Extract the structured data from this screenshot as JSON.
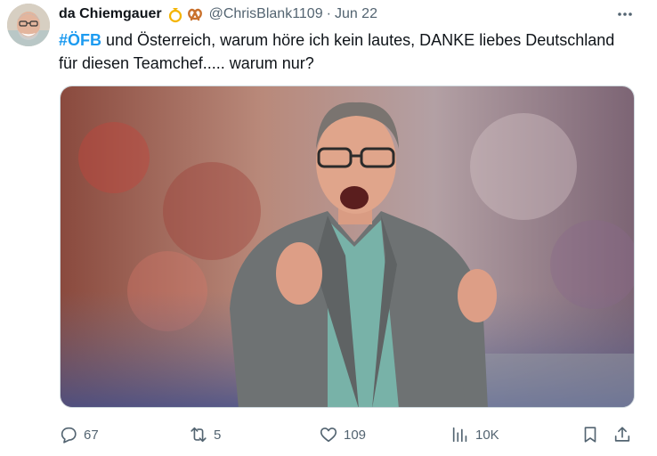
{
  "tweet": {
    "display_name": "da Chiemgauer",
    "badges": [
      "ring-emoji",
      "pretzel-emoji"
    ],
    "handle": "@ChrisBlank1109",
    "separator": "·",
    "date": "Jun 22",
    "hashtag": "#ÖFB",
    "text": " und Österreich, warum höre ich kein lautes, DANKE liebes Deutschland für diesen Teamchef..... warum nur?"
  },
  "actions": {
    "replies": "67",
    "reposts": "5",
    "likes": "109",
    "views": "10K"
  },
  "colors": {
    "accent": "#1d9bf0",
    "secondary_text": "#536471",
    "primary_text": "#0f1419"
  },
  "icons": [
    "more-icon",
    "reply-icon",
    "repost-icon",
    "like-icon",
    "views-icon",
    "bookmark-icon",
    "share-icon"
  ]
}
